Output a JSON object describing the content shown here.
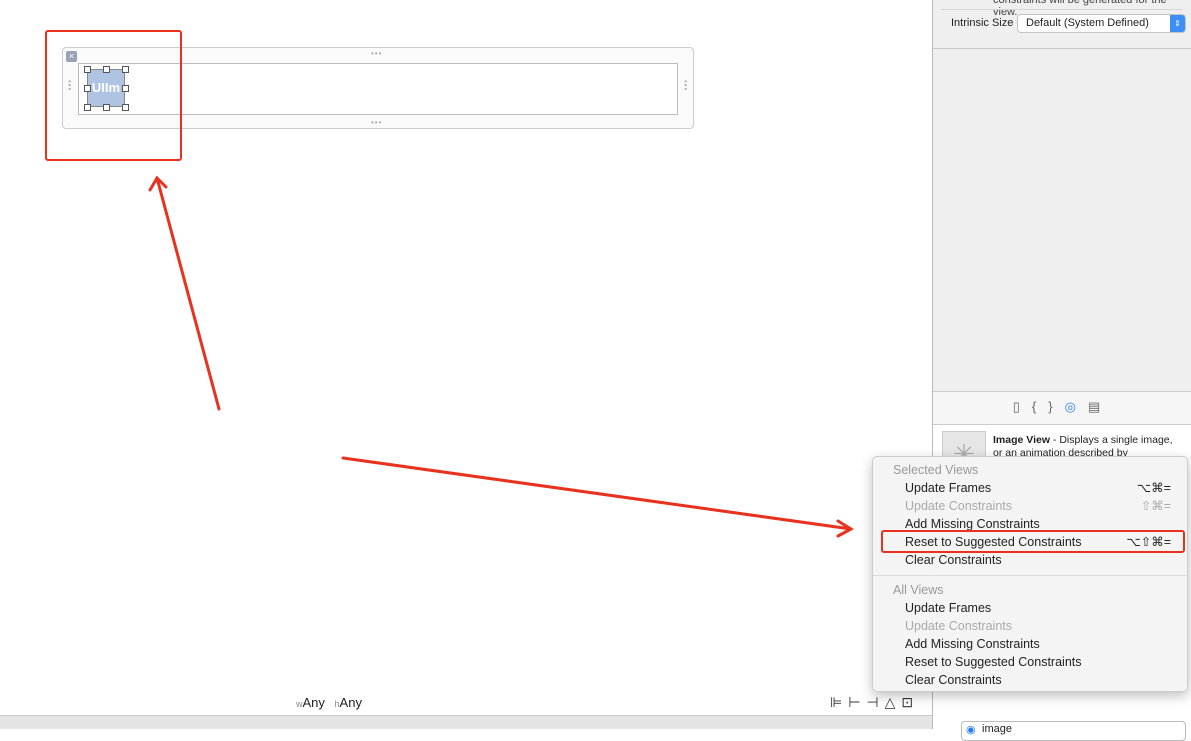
{
  "canvas": {
    "image_view_label": "UIIm",
    "size_class": {
      "w_prefix": "w",
      "w_value": "Any",
      "h_prefix": "h",
      "h_value": "Any"
    },
    "tools": [
      "align-icon",
      "pin-icon",
      "resolve-issues-icon",
      "resizing-icon"
    ]
  },
  "inspector": {
    "cut_text": "constraints will be generated for the view.",
    "intrinsic_size_label": "Intrinsic Size",
    "intrinsic_size_value": "Default (System Defined)"
  },
  "library": {
    "tabs": [
      "file-template-icon",
      "code-snippet-icon",
      "object-icon",
      "media-icon"
    ],
    "selected_tab": 2,
    "item_title": "Image View",
    "item_desc": " - Displays a single image, or an animation described by",
    "search_value": "image"
  },
  "menu": {
    "sections": [
      {
        "header": "Selected Views",
        "items": [
          {
            "label": "Update Frames",
            "shortcut": "⌥⌘=",
            "enabled": true
          },
          {
            "label": "Update Constraints",
            "shortcut": "⇧⌘=",
            "enabled": false
          },
          {
            "label": "Add Missing Constraints",
            "shortcut": "",
            "enabled": true
          },
          {
            "label": "Reset to Suggested Constraints",
            "shortcut": "⌥⇧⌘=",
            "enabled": true
          },
          {
            "label": "Clear Constraints",
            "shortcut": "",
            "enabled": true
          }
        ]
      },
      {
        "header": "All Views",
        "items": [
          {
            "label": "Update Frames",
            "shortcut": "",
            "enabled": true
          },
          {
            "label": "Update Constraints",
            "shortcut": "",
            "enabled": false
          },
          {
            "label": "Add Missing Constraints",
            "shortcut": "",
            "enabled": true
          },
          {
            "label": "Reset to Suggested Constraints",
            "shortcut": "",
            "enabled": true
          },
          {
            "label": "Clear Constraints",
            "shortcut": "",
            "enabled": true
          }
        ]
      }
    ]
  },
  "annotation_color": "#e8321e"
}
